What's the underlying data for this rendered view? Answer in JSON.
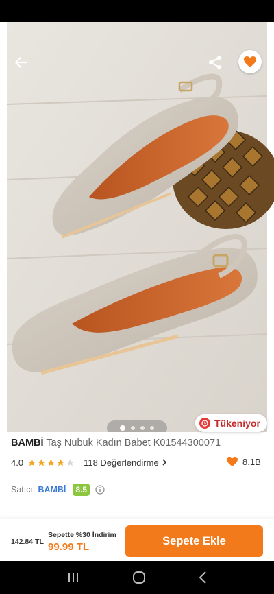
{
  "product": {
    "brand": "BAMBİ",
    "name": "Taş Nubuk Kadın Babet K01544300071",
    "rating": "4.0",
    "stars_filled": 4,
    "stars_total": 5,
    "reviews_label": "118 Değerlendirme",
    "favorites": "8.1B"
  },
  "gallery": {
    "image_count": 4,
    "active_index": 0,
    "stock_label": "Tükeniyor"
  },
  "seller": {
    "label": "Satıcı:",
    "name": "BAMBİ",
    "score": "8.5"
  },
  "purchase": {
    "old_price": "142.84 TL",
    "promo": "Sepette %30 İndirim",
    "new_price": "99.99 TL",
    "cart_button": "Sepete Ekle"
  },
  "colors": {
    "accent": "#f27a1a",
    "stock_red": "#e5393a",
    "seller_score_green": "#8cc63f"
  }
}
